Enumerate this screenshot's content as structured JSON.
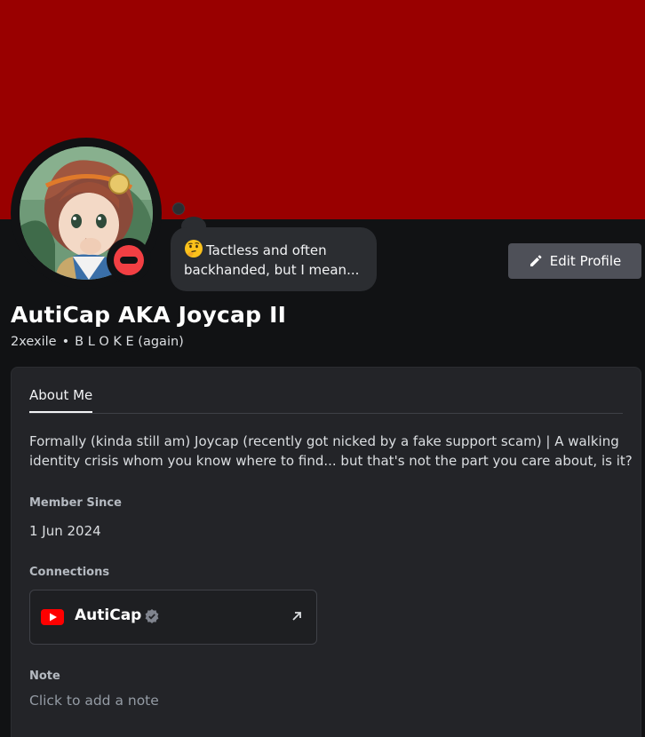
{
  "profile": {
    "display_name": "AutiCap AKA Joycap II",
    "username": "2xexile",
    "separator": "•",
    "pronouns": "B L O K E (again)",
    "status_icon": "do-not-disturb-icon",
    "banner_color": "#990000"
  },
  "custom_status": {
    "emoji": "thinking-face-emoji",
    "text_line1": "Tactless and often",
    "text_line2": "backhanded, but I mean..."
  },
  "actions": {
    "edit_profile_label": "Edit Profile"
  },
  "tabs": {
    "about_me": "About Me"
  },
  "about_me": {
    "text": "Formally (kinda still am) Joycap (recently got nicked by a fake support scam) | A walking identity crisis whom you know where to find... but that's not the part you care about, is it?"
  },
  "member_since": {
    "heading": "Member Since",
    "value": "1 Jun 2024"
  },
  "connections": {
    "heading": "Connections",
    "items": [
      {
        "service_icon": "youtube-icon",
        "name": "AutiCap",
        "verified": true
      }
    ]
  },
  "note": {
    "heading": "Note",
    "placeholder": "Click to add a note"
  }
}
